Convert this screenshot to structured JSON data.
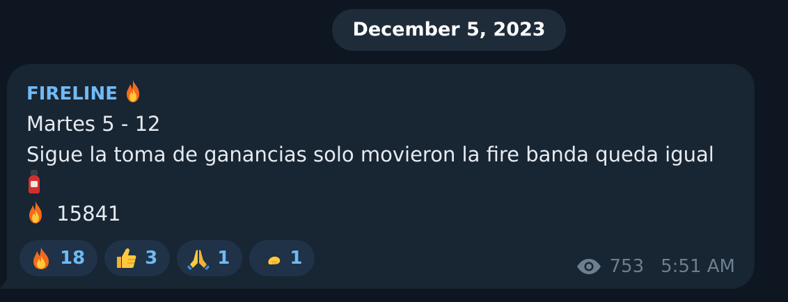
{
  "date_separator": "December 5, 2023",
  "message": {
    "sender": "FIRELINE",
    "sender_icon": "fire-emoji",
    "lines": [
      "Martes 5 - 12",
      "Sigue la toma de ganancias solo movieron la fire banda queda igual"
    ],
    "extinguisher_icon": "fire-extinguisher-emoji",
    "price_icon": "fire-emoji",
    "price": "15841",
    "reactions": [
      {
        "icon": "fire-emoji",
        "count": "18"
      },
      {
        "icon": "thumbs-up-emoji",
        "count": "3"
      },
      {
        "icon": "folded-hands-emoji",
        "count": "1"
      },
      {
        "icon": "writing-hand-emoji",
        "count": "1"
      }
    ],
    "views": "753",
    "time": "5:51 AM"
  },
  "colors": {
    "background": "#0e1621",
    "bubble": "#182533",
    "sender": "#71baf5",
    "reaction_bg": "#1f3247",
    "reaction_text": "#6fbaf4",
    "meta_text": "#6d7f8f"
  }
}
